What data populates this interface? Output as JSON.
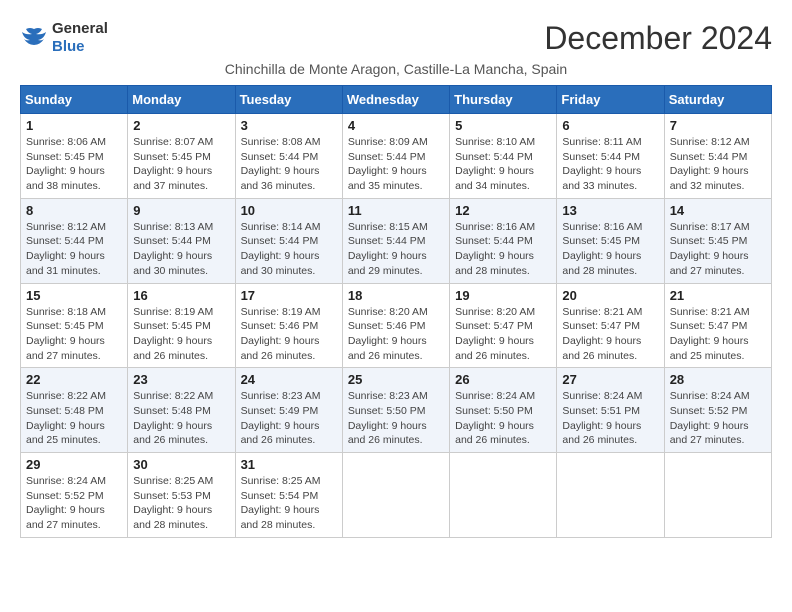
{
  "header": {
    "logo_general": "General",
    "logo_blue": "Blue",
    "title": "December 2024",
    "subtitle": "Chinchilla de Monte Aragon, Castille-La Mancha, Spain"
  },
  "calendar": {
    "days_of_week": [
      "Sunday",
      "Monday",
      "Tuesday",
      "Wednesday",
      "Thursday",
      "Friday",
      "Saturday"
    ],
    "weeks": [
      [
        null,
        null,
        null,
        null,
        null,
        null,
        null
      ]
    ],
    "cells": [
      {
        "day": 1,
        "sunrise": "8:06 AM",
        "sunset": "5:45 PM",
        "daylight": "9 hours and 38 minutes."
      },
      {
        "day": 2,
        "sunrise": "8:07 AM",
        "sunset": "5:45 PM",
        "daylight": "9 hours and 37 minutes."
      },
      {
        "day": 3,
        "sunrise": "8:08 AM",
        "sunset": "5:44 PM",
        "daylight": "9 hours and 36 minutes."
      },
      {
        "day": 4,
        "sunrise": "8:09 AM",
        "sunset": "5:44 PM",
        "daylight": "9 hours and 35 minutes."
      },
      {
        "day": 5,
        "sunrise": "8:10 AM",
        "sunset": "5:44 PM",
        "daylight": "9 hours and 34 minutes."
      },
      {
        "day": 6,
        "sunrise": "8:11 AM",
        "sunset": "5:44 PM",
        "daylight": "9 hours and 33 minutes."
      },
      {
        "day": 7,
        "sunrise": "8:12 AM",
        "sunset": "5:44 PM",
        "daylight": "9 hours and 32 minutes."
      },
      {
        "day": 8,
        "sunrise": "8:12 AM",
        "sunset": "5:44 PM",
        "daylight": "9 hours and 31 minutes."
      },
      {
        "day": 9,
        "sunrise": "8:13 AM",
        "sunset": "5:44 PM",
        "daylight": "9 hours and 30 minutes."
      },
      {
        "day": 10,
        "sunrise": "8:14 AM",
        "sunset": "5:44 PM",
        "daylight": "9 hours and 30 minutes."
      },
      {
        "day": 11,
        "sunrise": "8:15 AM",
        "sunset": "5:44 PM",
        "daylight": "9 hours and 29 minutes."
      },
      {
        "day": 12,
        "sunrise": "8:16 AM",
        "sunset": "5:44 PM",
        "daylight": "9 hours and 28 minutes."
      },
      {
        "day": 13,
        "sunrise": "8:16 AM",
        "sunset": "5:45 PM",
        "daylight": "9 hours and 28 minutes."
      },
      {
        "day": 14,
        "sunrise": "8:17 AM",
        "sunset": "5:45 PM",
        "daylight": "9 hours and 27 minutes."
      },
      {
        "day": 15,
        "sunrise": "8:18 AM",
        "sunset": "5:45 PM",
        "daylight": "9 hours and 27 minutes."
      },
      {
        "day": 16,
        "sunrise": "8:19 AM",
        "sunset": "5:45 PM",
        "daylight": "9 hours and 26 minutes."
      },
      {
        "day": 17,
        "sunrise": "8:19 AM",
        "sunset": "5:46 PM",
        "daylight": "9 hours and 26 minutes."
      },
      {
        "day": 18,
        "sunrise": "8:20 AM",
        "sunset": "5:46 PM",
        "daylight": "9 hours and 26 minutes."
      },
      {
        "day": 19,
        "sunrise": "8:20 AM",
        "sunset": "5:47 PM",
        "daylight": "9 hours and 26 minutes."
      },
      {
        "day": 20,
        "sunrise": "8:21 AM",
        "sunset": "5:47 PM",
        "daylight": "9 hours and 26 minutes."
      },
      {
        "day": 21,
        "sunrise": "8:21 AM",
        "sunset": "5:47 PM",
        "daylight": "9 hours and 25 minutes."
      },
      {
        "day": 22,
        "sunrise": "8:22 AM",
        "sunset": "5:48 PM",
        "daylight": "9 hours and 25 minutes."
      },
      {
        "day": 23,
        "sunrise": "8:22 AM",
        "sunset": "5:48 PM",
        "daylight": "9 hours and 26 minutes."
      },
      {
        "day": 24,
        "sunrise": "8:23 AM",
        "sunset": "5:49 PM",
        "daylight": "9 hours and 26 minutes."
      },
      {
        "day": 25,
        "sunrise": "8:23 AM",
        "sunset": "5:50 PM",
        "daylight": "9 hours and 26 minutes."
      },
      {
        "day": 26,
        "sunrise": "8:24 AM",
        "sunset": "5:50 PM",
        "daylight": "9 hours and 26 minutes."
      },
      {
        "day": 27,
        "sunrise": "8:24 AM",
        "sunset": "5:51 PM",
        "daylight": "9 hours and 26 minutes."
      },
      {
        "day": 28,
        "sunrise": "8:24 AM",
        "sunset": "5:52 PM",
        "daylight": "9 hours and 27 minutes."
      },
      {
        "day": 29,
        "sunrise": "8:24 AM",
        "sunset": "5:52 PM",
        "daylight": "9 hours and 27 minutes."
      },
      {
        "day": 30,
        "sunrise": "8:25 AM",
        "sunset": "5:53 PM",
        "daylight": "9 hours and 28 minutes."
      },
      {
        "day": 31,
        "sunrise": "8:25 AM",
        "sunset": "5:54 PM",
        "daylight": "9 hours and 28 minutes."
      }
    ]
  }
}
